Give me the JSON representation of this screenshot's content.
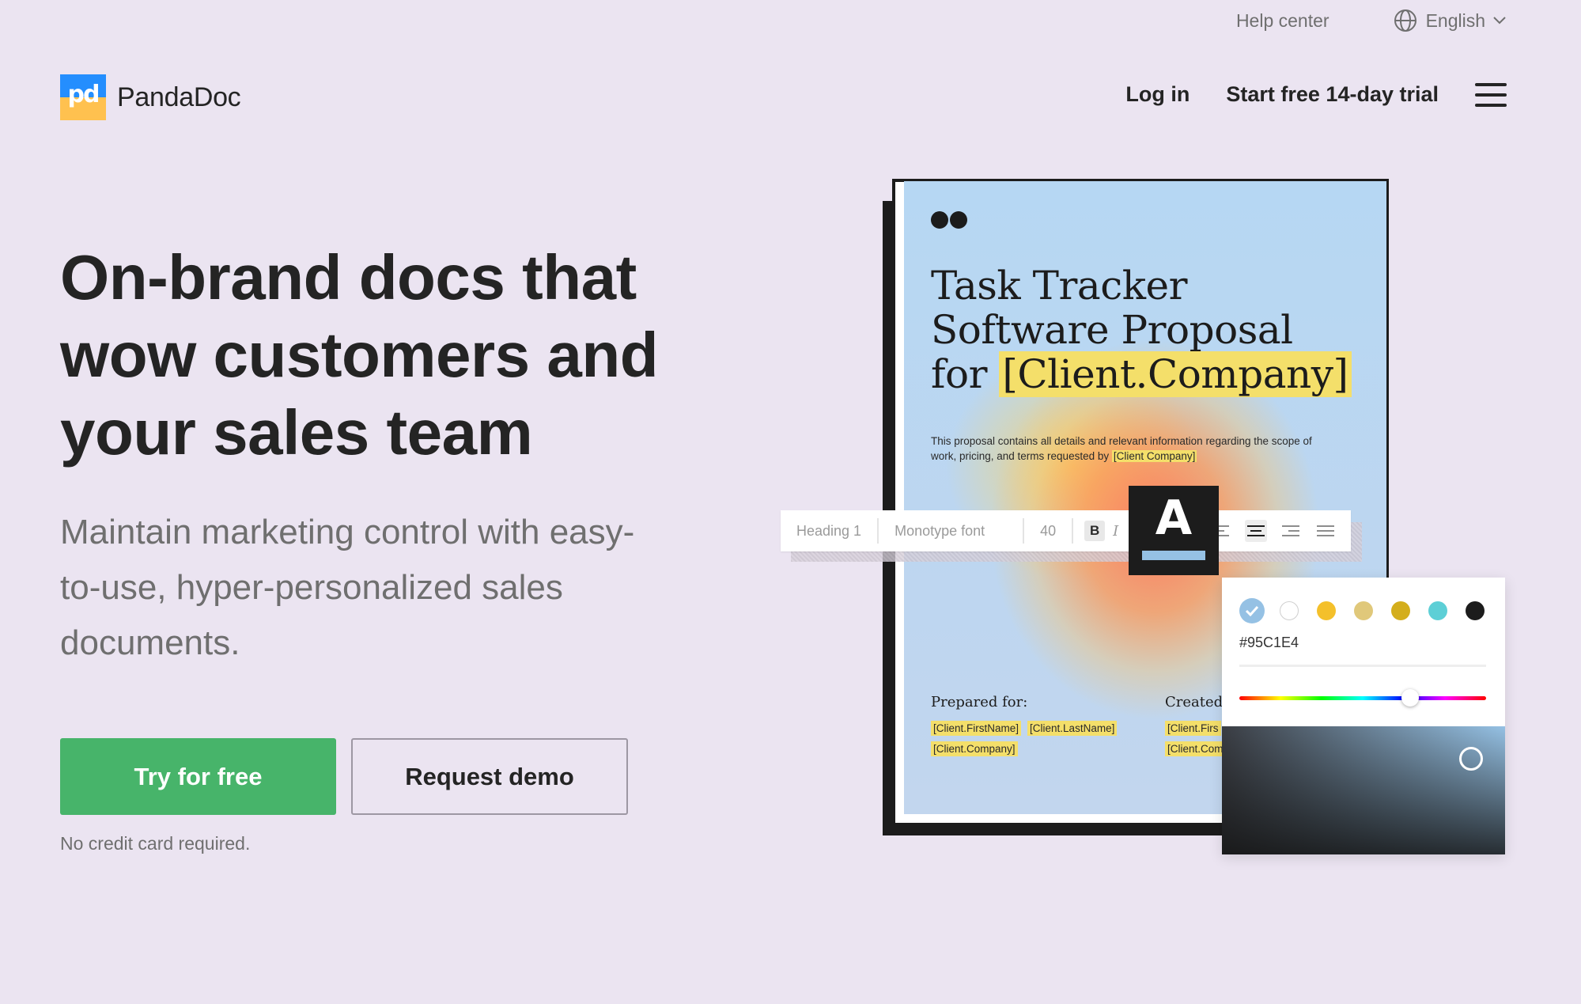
{
  "utility": {
    "help": "Help center",
    "language": "English"
  },
  "header": {
    "brand": "PandaDoc",
    "logo_mark": "pd",
    "login": "Log in",
    "trial": "Start free 14-day trial"
  },
  "hero": {
    "title": "On-brand docs that wow customers and your sales team",
    "subtitle": "Maintain marketing control with easy-to-use, hyper-personalized sales documents.",
    "primary_cta": "Try for free",
    "secondary_cta": "Request demo",
    "note": "No credit card required."
  },
  "document": {
    "title_line1": "Task Tracker",
    "title_line2": "Software Proposal",
    "title_for": "for",
    "title_var": "[Client.Company]",
    "desc_text": "This proposal contains all details and relevant information regarding the scope of work, pricing, and terms requested by",
    "desc_var": "[Client Company]",
    "prepared_for": "Prepared for:",
    "created_by": "Created b",
    "tags": [
      "[Client.FirstName]",
      "[Client.LastName]",
      "[Client.Company]"
    ],
    "tags_right": [
      "[Client.Firs",
      "[Client.Com"
    ]
  },
  "toolbar": {
    "style": "Heading 1",
    "font": "Monotype font",
    "size": "40",
    "bold": "B",
    "italic": "I"
  },
  "font_preview": {
    "letter": "A"
  },
  "color_picker": {
    "hex": "#95C1E4",
    "swatches": [
      "#95c1e4",
      "#ffffff",
      "#f4c02b",
      "#e0c87a",
      "#d4ae1c",
      "#5dcfd6",
      "#1c1c1c"
    ]
  },
  "colors": {
    "background": "#ebe4f1",
    "primary": "#47b46a",
    "text": "#242424",
    "highlight": "#f4df6a"
  }
}
